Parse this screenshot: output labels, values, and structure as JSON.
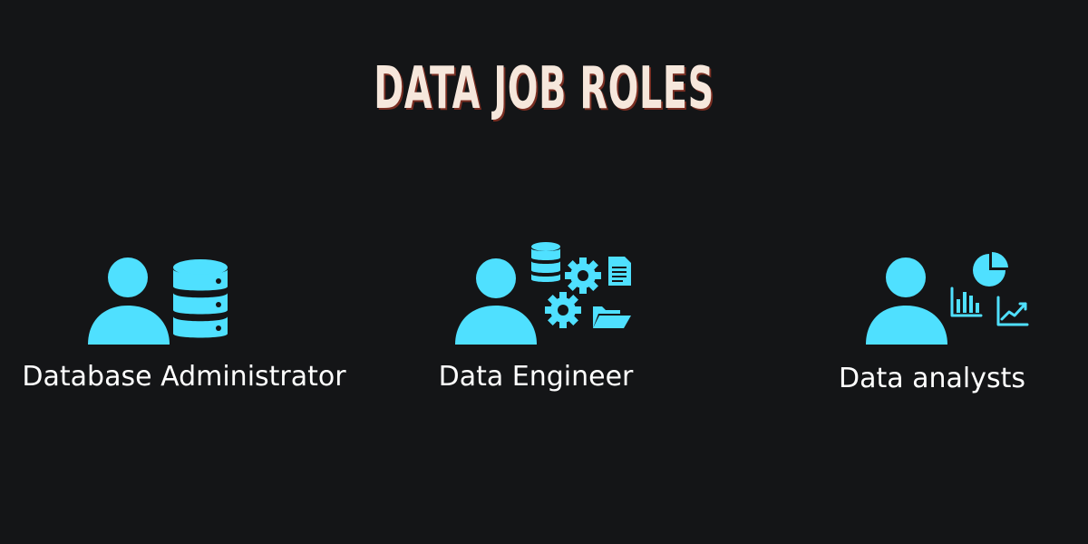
{
  "title": "DATA JOB ROLES",
  "accent_color": "#4fe0ff",
  "roles": [
    {
      "label": "Database Administrator",
      "icon": "person-database-icon"
    },
    {
      "label": "Data Engineer",
      "icon": "person-gears-icon"
    },
    {
      "label": "Data analysts",
      "icon": "person-charts-icon"
    }
  ]
}
